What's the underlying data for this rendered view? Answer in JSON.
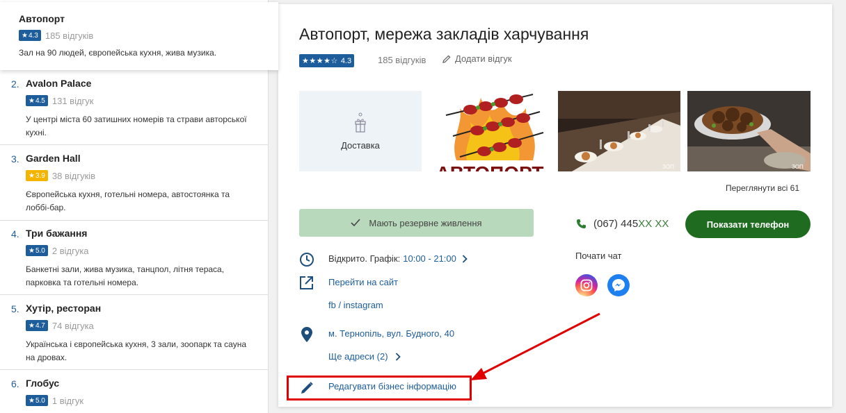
{
  "sidebar": {
    "items": [
      {
        "num": "",
        "name": "Автопорт",
        "rating": "4.3",
        "reviews": "185 відгуків",
        "desc": "Зал на 90 людей, європейська кухня, жива музика.",
        "badge_color": "#1d5d9b"
      },
      {
        "num": "2.",
        "name": "Avalon Palace",
        "rating": "4.5",
        "reviews": "131 відгук",
        "desc": "У центрі міста 60 затишних номерів та страви авторської кухні.",
        "badge_color": "#1d5d9b"
      },
      {
        "num": "3.",
        "name": "Garden Hall",
        "rating": "3.9",
        "reviews": "38 відгуків",
        "desc": "Європейська кухня, готельні номера, автостоянка та лоббі-бар.",
        "badge_color": "#f5b400"
      },
      {
        "num": "4.",
        "name": "Три бажання",
        "rating": "5.0",
        "reviews": "2 відгука",
        "desc": "Банкетні зали, жива музика, танцпол, літня тераса, парковка та готельні номера.",
        "badge_color": "#1d5d9b"
      },
      {
        "num": "5.",
        "name": "Хутір, ресторан",
        "rating": "4.7",
        "reviews": "74 відгука",
        "desc": "Українська і європейська кухня, 3 зали, зоопарк та сауна на дровах.",
        "badge_color": "#1d5d9b"
      },
      {
        "num": "6.",
        "name": "Глобус",
        "rating": "5.0",
        "reviews": "1 відгук",
        "desc": "",
        "badge_color": "#1d5d9b"
      }
    ]
  },
  "main": {
    "title": "Автопорт, мережа закладів харчування",
    "stars": "★★★★☆",
    "rating": "4.3",
    "reviews": "185 відгуків",
    "add_review": "Додати відгук",
    "delivery": "Доставка",
    "logo_text": "АВТОПОРТ",
    "photo_watermark": "ЗОП",
    "see_all": "Переглянути всі 61",
    "backup_power": "Мають резервне живлення",
    "phone_visible": "(067) 445",
    "phone_masked": "XX XX",
    "show_phone": "Показати телефон",
    "chat_title": "Почати чат",
    "schedule_prefix": "Відкрито. Графік:",
    "schedule_hours": "10:00 - 21:00",
    "website": "Перейти на сайт",
    "social": "fb / instagram",
    "address": "м. Тернопіль, вул. Будного, 40",
    "more_addresses": "Ще адреси (2)",
    "edit_business": "Редагувати бізнес інформацію"
  },
  "colors": {
    "brand_blue": "#1d5d9b",
    "green_button": "#1f6c20",
    "backup_bg": "#b9d9bd",
    "annotation_red": "#e00000"
  },
  "icons": [
    "star-icon",
    "pencil-icon",
    "gift-icon",
    "check-icon",
    "phone-icon",
    "instagram-icon",
    "messenger-icon",
    "clock-icon",
    "external-link-icon",
    "map-pin-icon",
    "chevron-right-icon",
    "edit-icon"
  ]
}
